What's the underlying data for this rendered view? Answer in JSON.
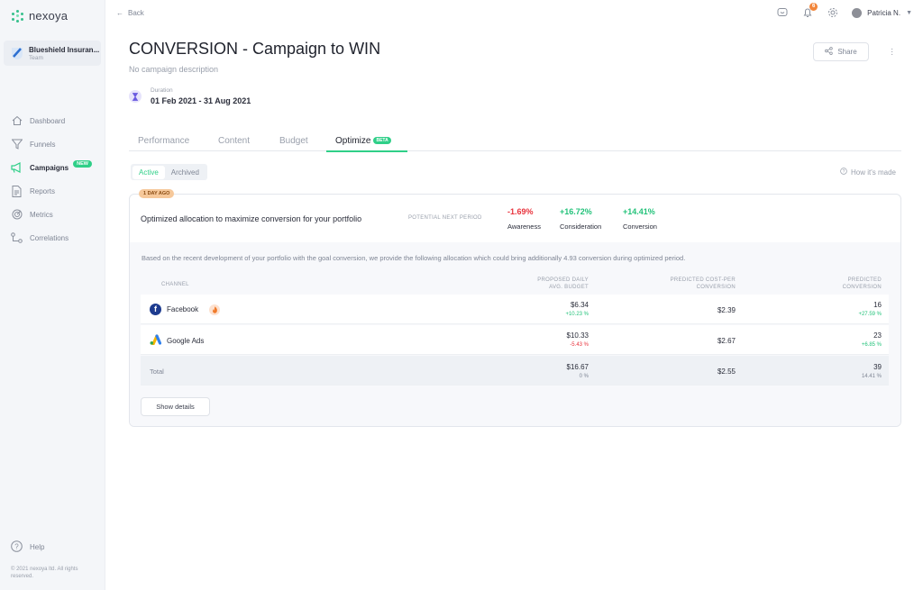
{
  "app": {
    "logo_text": "nexoya"
  },
  "team": {
    "name": "Blueshield Insuran...",
    "subtitle": "Team"
  },
  "sidebar": {
    "items": [
      {
        "label": "Dashboard",
        "icon": "home-icon",
        "active": false
      },
      {
        "label": "Funnels",
        "icon": "funnel-icon",
        "active": false
      },
      {
        "label": "Campaigns",
        "icon": "megaphone-icon",
        "active": true,
        "badge": "NEW"
      },
      {
        "label": "Reports",
        "icon": "report-icon",
        "active": false
      },
      {
        "label": "Metrics",
        "icon": "metrics-icon",
        "active": false
      },
      {
        "label": "Correlations",
        "icon": "correlations-icon",
        "active": false
      }
    ],
    "help": "Help",
    "copyright": "© 2021 nexoya ltd. All rights reserved."
  },
  "topbar": {
    "back": "Back",
    "notifications": "6",
    "user": "Patricia N."
  },
  "header": {
    "title": "CONVERSION - Campaign to WIN",
    "description": "No campaign description",
    "share": "Share",
    "duration_label": "Duration",
    "duration_value": "01 Feb 2021 - 31 Aug 2021"
  },
  "tabs": [
    {
      "label": "Performance"
    },
    {
      "label": "Content"
    },
    {
      "label": "Budget"
    },
    {
      "label": "Optimize",
      "badge": "BETA",
      "active": true
    }
  ],
  "subtabs": {
    "active": "Active",
    "archived": "Archived",
    "howto": "How it's made"
  },
  "card": {
    "ago": "1 DAY AGO",
    "title": "Optimized allocation to maximize conversion for your portfolio",
    "next_period": "POTENTIAL NEXT PERIOD",
    "kpis": [
      {
        "value": "-1.69%",
        "label": "Awareness",
        "trend": "down"
      },
      {
        "value": "+16.72%",
        "label": "Consideration",
        "trend": "up"
      },
      {
        "value": "+14.41%",
        "label": "Conversion",
        "trend": "up"
      }
    ],
    "explanation": "Based on the recent development of your portfolio with the goal conversion, we provide the following allocation which could bring additionally 4.93 conversion during optimized period.",
    "columns": {
      "channel": "CHANNEL",
      "budget_1": "PROPOSED DAILY",
      "budget_2": "AVG. BUDGET",
      "cpc_1": "PREDICTED COST-PER",
      "cpc_2": "CONVERSION",
      "conv_1": "PREDICTED",
      "conv_2": "CONVERSION"
    },
    "rows": [
      {
        "channel": "Facebook",
        "budget": "$6.34",
        "budget_change": "+10.23 %",
        "cpc": "$2.39",
        "conversion": "16",
        "conversion_change": "+27.59 %"
      },
      {
        "channel": "Google Ads",
        "budget": "$10.33",
        "budget_change": "-5.43 %",
        "cpc": "$2.67",
        "conversion": "23",
        "conversion_change": "+6.85 %"
      }
    ],
    "total": {
      "label": "Total",
      "budget": "$16.67",
      "budget_change": "0 %",
      "cpc": "$2.55",
      "conversion": "39",
      "conversion_change": "14.41 %"
    },
    "show_details": "Show details"
  },
  "colors": {
    "accent": "#2fcf88",
    "negative": "#e8323c",
    "positive": "#23c27a",
    "badge_orange": "#f2853a"
  }
}
